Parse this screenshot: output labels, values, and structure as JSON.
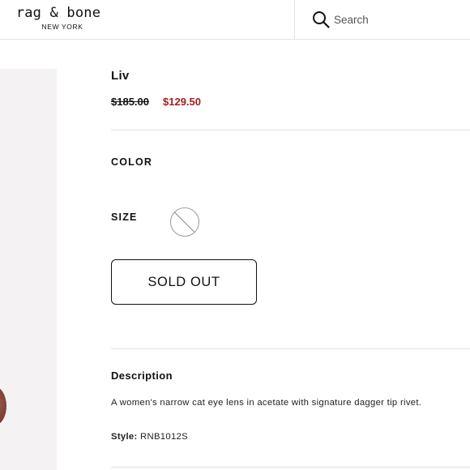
{
  "header": {
    "brand_name": "rag & bone",
    "brand_sub": "NEW YORK",
    "search_placeholder": "Search"
  },
  "product": {
    "title": "Liv",
    "price_original": "$185.00",
    "price_sale": "$129.50",
    "color_label": "COLOR",
    "size_label": "SIZE",
    "size_option_state": "unavailable",
    "sold_out_label": "SOLD OUT",
    "description_heading": "Description",
    "description_text": "A women's narrow cat eye lens in acetate with signature dagger tip rivet.",
    "style_label": "Style:",
    "style_value": "RNB1012S"
  },
  "colors": {
    "sale_price": "#a41d1d",
    "divider": "#e2e2e2",
    "image_bg": "#f4f2f2"
  },
  "icons": {
    "search": "search-icon"
  }
}
